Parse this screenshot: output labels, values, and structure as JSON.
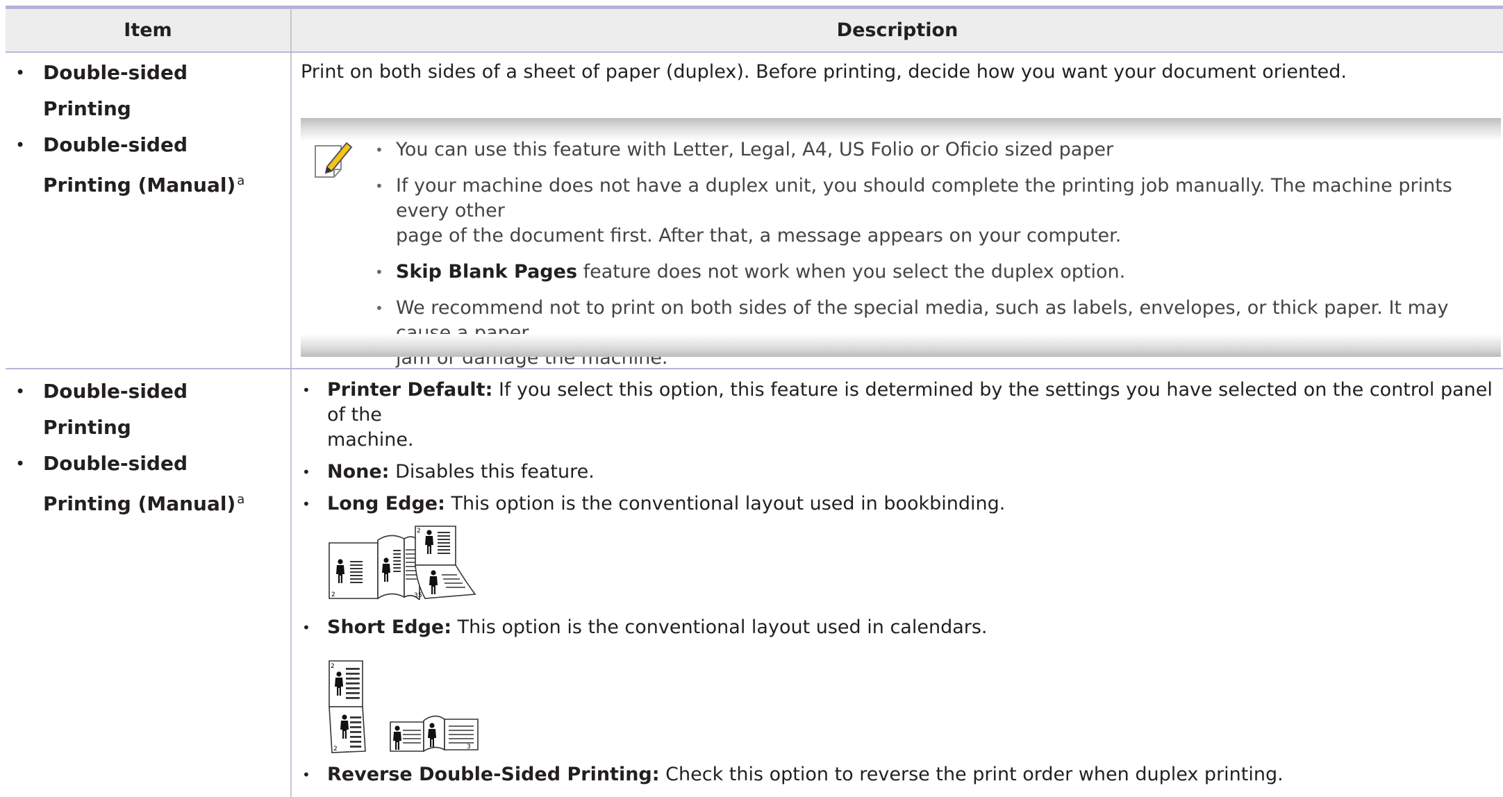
{
  "table": {
    "header": {
      "item": "Item",
      "description": "Description"
    },
    "row1": {
      "items": [
        "Double-sided Printing",
        "Double-sided Printing (Manual)"
      ],
      "footnote_mark": "a",
      "intro": "Print on both sides of a sheet of paper (duplex). Before printing, decide how you want your document oriented.",
      "note_icon": "pencil-note-icon",
      "notes": {
        "n1": "You can use this feature with Letter, Legal, A4, US Folio or Oficio sized paper",
        "n2_line1": "If your machine does not have a duplex unit, you should complete the printing job manually. The machine prints every other",
        "n2_line2": "page of the document first. After that, a message appears on your computer.",
        "n3_bold": "Skip Blank Pages",
        "n3_rest": " feature does not work when you select the duplex option.",
        "n4_line1": "We recommend not to print on both sides of the special media, such as labels, envelopes, or thick paper. It may cause a paper",
        "n4_line2": "jam or damage the machine."
      }
    },
    "row2": {
      "items": [
        "Double-sided Printing",
        "Double-sided Printing (Manual)"
      ],
      "footnote_mark": "a",
      "options": {
        "printer_default_label": "Printer Default:",
        "printer_default_line1": " If you select this option, this feature is determined by the settings you have selected on the control panel of the",
        "printer_default_line2": "machine.",
        "none_label": "None:",
        "none_text": " Disables this feature.",
        "long_edge_label": "Long Edge:",
        "long_edge_text": " This option is the conventional layout used in bookbinding.",
        "short_edge_label": "Short Edge:",
        "short_edge_text": " This option is the conventional layout used in calendars.",
        "reverse_label": "Reverse Double-Sided Printing:",
        "reverse_text": " Check this option to reverse the print order when duplex printing."
      },
      "page_numbers": [
        "2",
        "3",
        "5"
      ]
    }
  },
  "colors": {
    "header_bg": "#ededed",
    "rule": "#b4b2d6",
    "text": "#231f20",
    "note_text": "#444444"
  }
}
